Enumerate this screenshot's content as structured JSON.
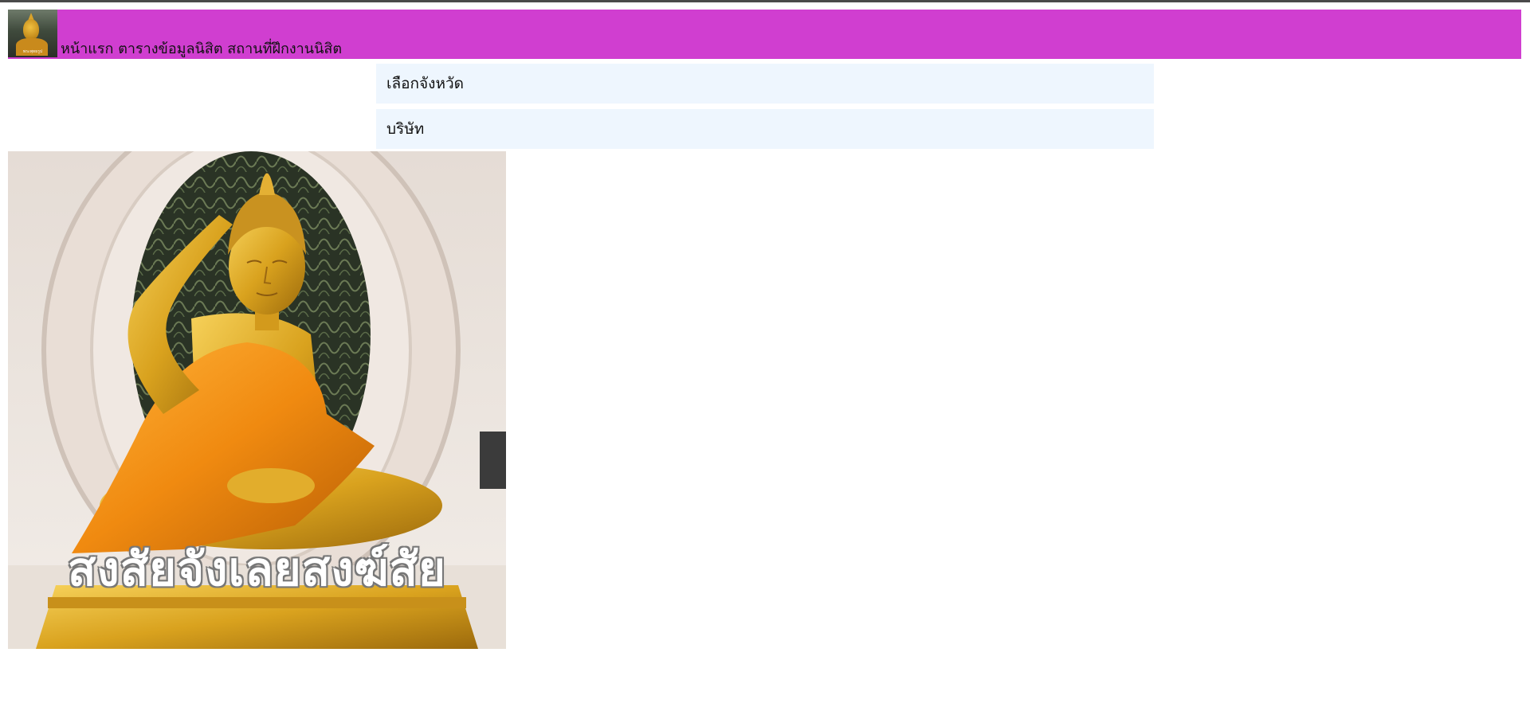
{
  "nav": {
    "logo_caption": "พระพุทธรูป",
    "links": [
      {
        "label": "หน้าแรก"
      },
      {
        "label": "ตารางข้อมูลนิสิต"
      },
      {
        "label": "สถานที่ฝึกงานนิสิต"
      }
    ],
    "bar_color": "#d03ed0"
  },
  "filters": {
    "province_label": "เลือกจังหวัด",
    "company_label": "บริษัท",
    "panel_color": "#eef6fe"
  },
  "hero": {
    "caption": "สงสัยจังเลยสงฆ์สัย",
    "image_subject": "golden-buddha-statue-icon"
  }
}
